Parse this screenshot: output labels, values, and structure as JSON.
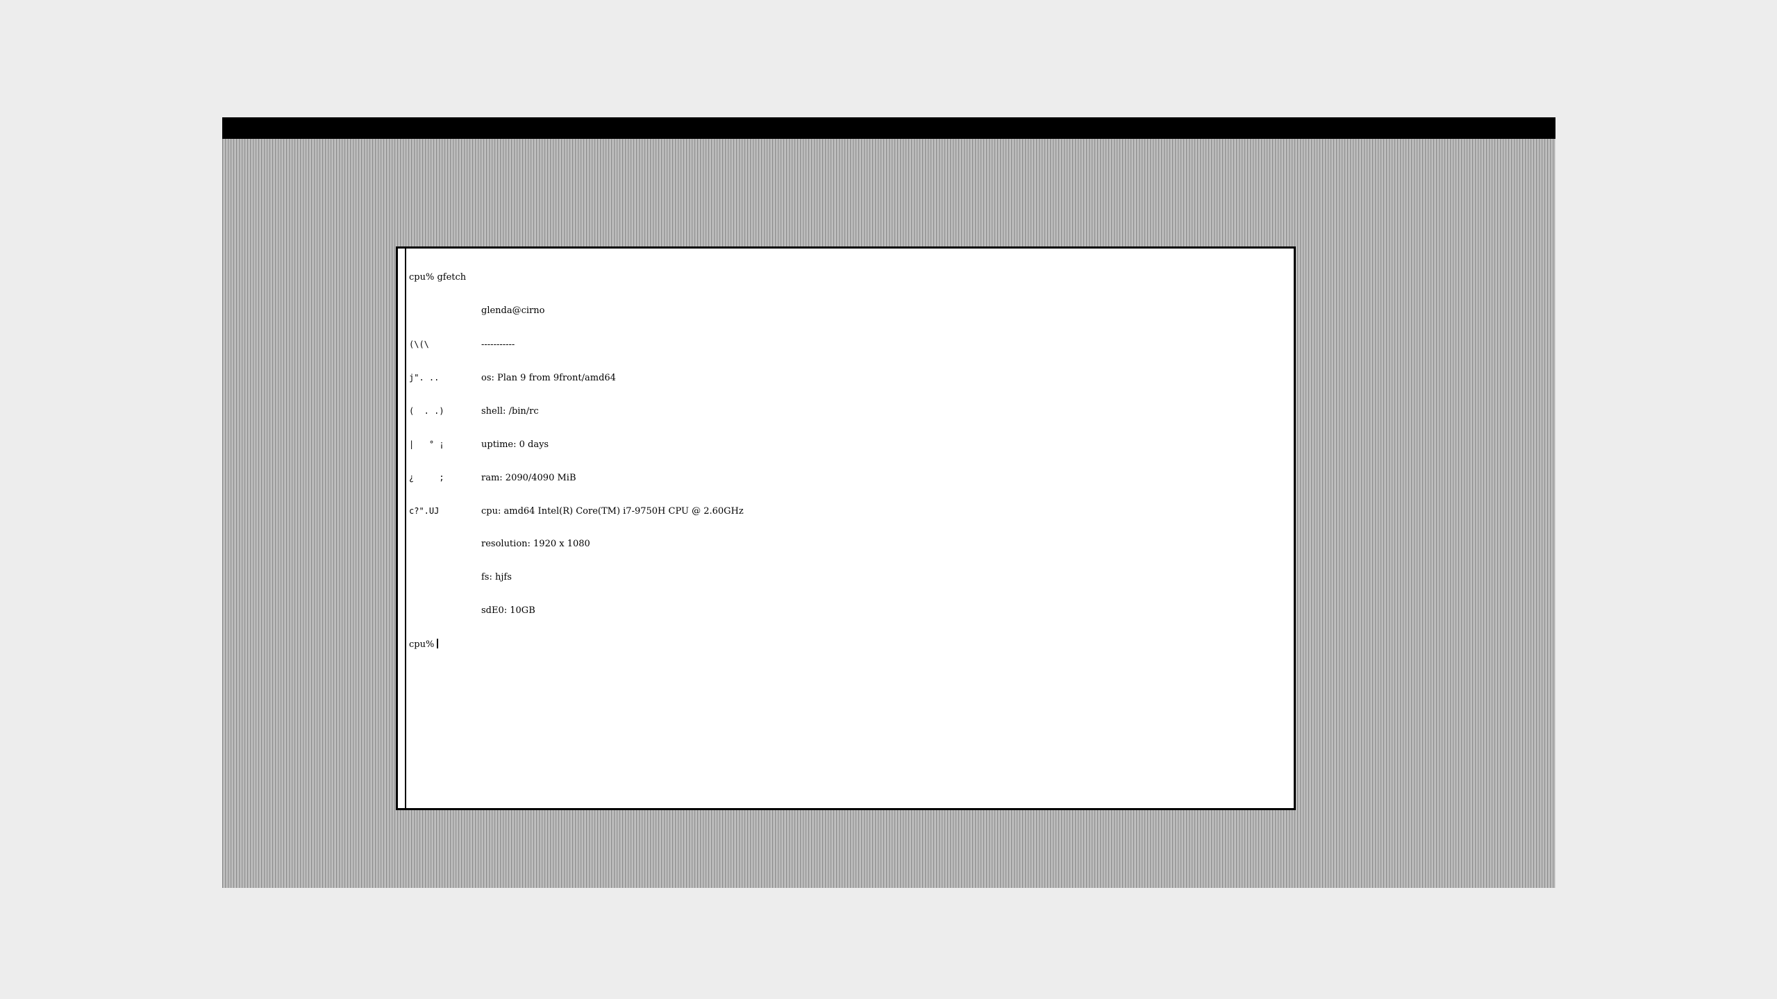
{
  "desktop": {
    "background": "#ededed",
    "screen_pattern": [
      "#7d7d7d",
      "#c6c6c6",
      "#ababab",
      "#d2d2d2"
    ]
  },
  "terminal": {
    "command_line": "cpu% gfetch",
    "prompt": "cpu%",
    "user_host": "glenda@cirno",
    "separator": "-----------",
    "art": [
      "(\\(\\",
      "j\". ..",
      "(  . .)",
      "|   ° ¡",
      "¿     ;",
      "c?\".UJ"
    ],
    "info": [
      "os: Plan 9 from 9front/amd64",
      "shell: /bin/rc",
      "uptime: 0 days",
      "ram: 2090/4090 MiB",
      "cpu: amd64 Intel(R) Core(TM) i7-9750H CPU @ 2.60GHz",
      "resolution: 1920 x 1080",
      "fs: hjfs",
      "sdE0: 10GB"
    ]
  }
}
